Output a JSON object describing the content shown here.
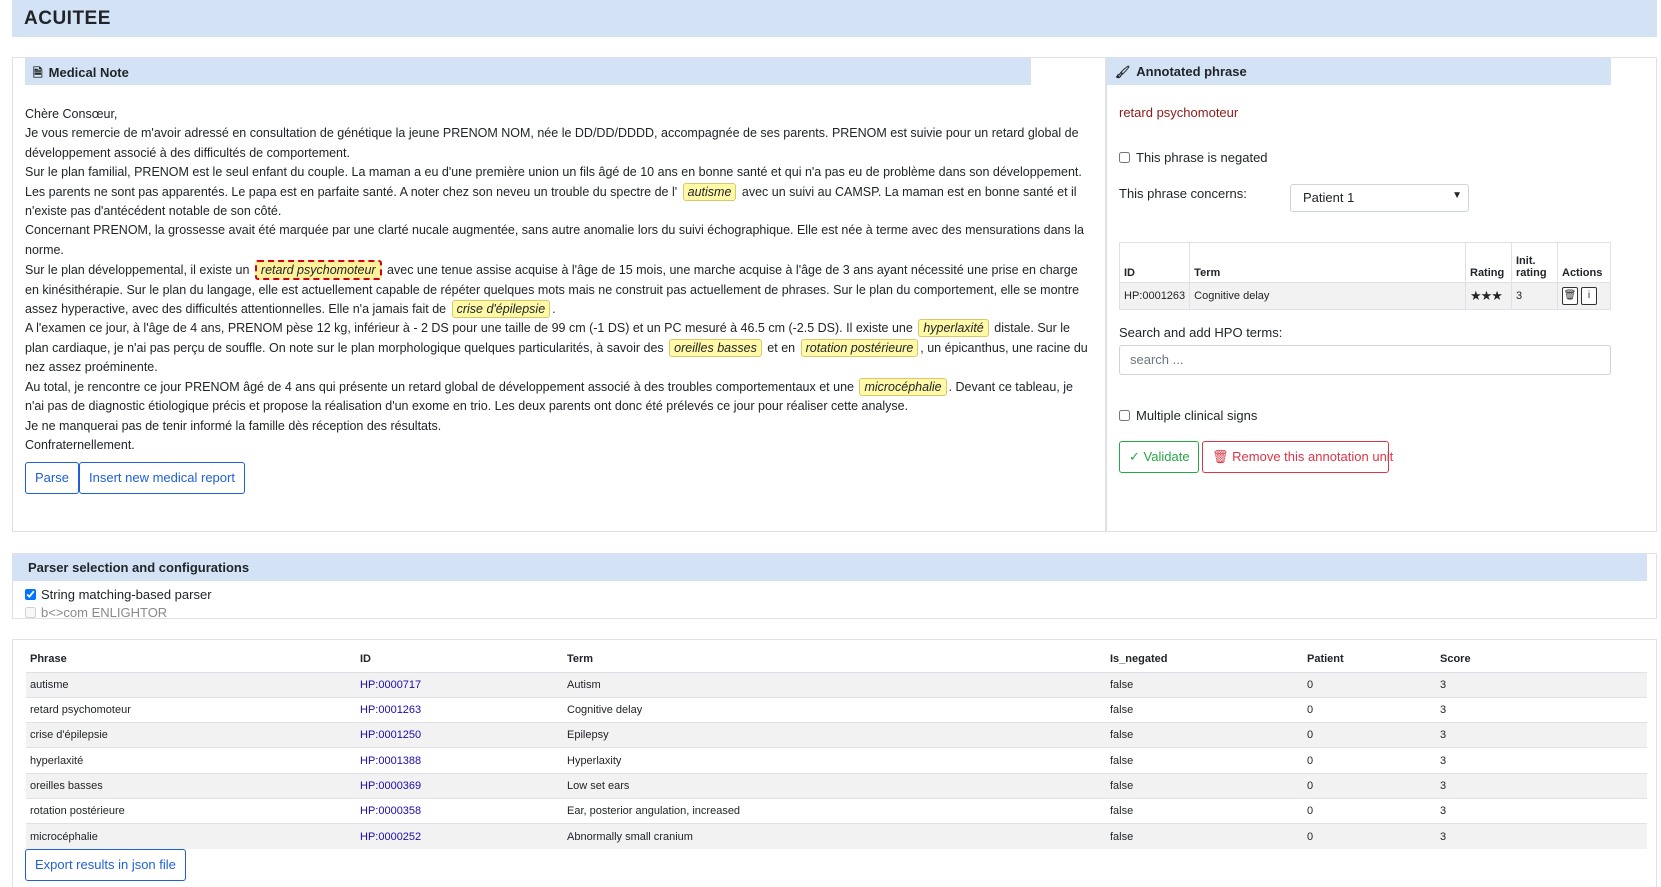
{
  "app": {
    "title": "ACUITEE"
  },
  "note": {
    "header": "Medical Note",
    "header_icon": "file-icon",
    "segments": [
      {
        "t": "Chère Consœur,"
      },
      {
        "br": true
      },
      {
        "t": "Je vous remercie de m'avoir adressé en consultation de génétique la jeune PRENOM NOM, née le DD/DD/DDDD, accompagnée de ses parents. PRENOM est suivie pour un retard global de développement associé à des difficultés de comportement."
      },
      {
        "br": true
      },
      {
        "t": "Sur le plan familial, PRENOM est le seul enfant du couple. La maman a eu d'une première union un fils âgé de 10 ans en bonne santé et qui n'a pas eu de problème dans son développement. Les parents ne sont pas apparentés. Le papa est en parfaite santé. A noter chez son neveu un trouble du spectre de l' "
      },
      {
        "hl": "autisme"
      },
      {
        "t": " avec un suivi au CAMSP. La maman est en bonne santé et il n'existe pas d'antécédent notable de son côté."
      },
      {
        "br": true
      },
      {
        "t": "Concernant PRENOM, la grossesse avait été marquée par une clarté nucale augmentée, sans autre anomalie lors du suivi échographique. Elle est née à terme avec des mensurations dans la norme."
      },
      {
        "br": true
      },
      {
        "t": "Sur le plan développemental, il existe un "
      },
      {
        "hl": "retard psychomoteur",
        "sel": true
      },
      {
        "t": " avec une tenue assise acquise à l'âge de 15 mois, une marche acquise à l'âge de 3 ans ayant nécessité une prise en charge en kinésithérapie. Sur le plan du langage, elle est actuellement capable de répéter quelques mots mais ne construit pas actuellement de phrases. Sur le plan du comportement, elle se montre assez hyperactive, avec des difficultés attentionnelles. Elle n'a jamais fait de "
      },
      {
        "hl": "crise d'épilepsie"
      },
      {
        "t": "."
      },
      {
        "br": true
      },
      {
        "t": "A l'examen ce jour, à l'âge de 4 ans, PRENOM pèse 12 kg, inférieur à - 2 DS pour une taille de 99 cm (-1 DS) et un PC mesuré à 46.5 cm (-2.5 DS). Il existe une "
      },
      {
        "hl": "hyperlaxité"
      },
      {
        "t": " distale. Sur le plan cardiaque, je n'ai pas perçu de souffle. On note sur le plan morphologique quelques particularités, à savoir des "
      },
      {
        "hl": "oreilles basses"
      },
      {
        "t": " et en "
      },
      {
        "hl": "rotation postérieure"
      },
      {
        "t": ", un épicanthus, une racine du nez assez proéminente."
      },
      {
        "br": true
      },
      {
        "t": "Au total, je rencontre ce jour PRENOM âgé de 4 ans qui présente un retard global de développement associé à des troubles comportementaux et une "
      },
      {
        "hl": "microcéphalie"
      },
      {
        "t": ". Devant ce tableau, je n'ai pas de diagnostic étiologique précis et propose la réalisation d'un exome en trio. Les deux parents ont donc été prélevés ce jour pour réaliser cette analyse."
      },
      {
        "br": true
      },
      {
        "t": "Je ne manquerai pas de tenir informé la famille dès réception des résultats."
      },
      {
        "br": true
      },
      {
        "t": "Confraternellement."
      }
    ],
    "parse_button": "Parse",
    "insert_button": "Insert new medical report"
  },
  "annotation": {
    "header": "Annotated phrase",
    "header_icon": "pen-icon",
    "phrase": "retard psychomoteur",
    "negated_label": "This phrase is negated",
    "negated_checked": false,
    "concerns_label": "This phrase concerns:",
    "concerns_value": "Patient 1",
    "table_headers": [
      "ID",
      "Term",
      "Rating",
      "Init. rating",
      "Actions"
    ],
    "rows": [
      {
        "id": "HP:0001263",
        "term": "Cognitive delay",
        "rating": "★★★",
        "init_rating": "3"
      }
    ],
    "search_label": "Search and add HPO terms:",
    "search_placeholder": "search ...",
    "multiple_label": "Multiple clinical signs",
    "multiple_checked": false,
    "validate_button": "Validate",
    "remove_button": "Remove this annotation unit"
  },
  "parser": {
    "header": "Parser selection and configurations",
    "options": [
      {
        "label": "String matching-based parser",
        "checked": true,
        "disabled": false
      },
      {
        "label": "b<>com ENLIGHTOR",
        "checked": false,
        "disabled": true
      }
    ]
  },
  "results": {
    "headers": [
      "Phrase",
      "ID",
      "Term",
      "Is_negated",
      "Patient",
      "Score"
    ],
    "rows": [
      {
        "phrase": "autisme",
        "id": "HP:0000717",
        "term": "Autism",
        "neg": "false",
        "patient": "0",
        "score": "3"
      },
      {
        "phrase": "retard psychomoteur",
        "id": "HP:0001263",
        "term": "Cognitive delay",
        "neg": "false",
        "patient": "0",
        "score": "3"
      },
      {
        "phrase": "crise d'épilepsie",
        "id": "HP:0001250",
        "term": "Epilepsy",
        "neg": "false",
        "patient": "0",
        "score": "3"
      },
      {
        "phrase": "hyperlaxité",
        "id": "HP:0001388",
        "term": "Hyperlaxity",
        "neg": "false",
        "patient": "0",
        "score": "3"
      },
      {
        "phrase": "oreilles basses",
        "id": "HP:0000369",
        "term": "Low set ears",
        "neg": "false",
        "patient": "0",
        "score": "3"
      },
      {
        "phrase": "rotation postérieure",
        "id": "HP:0000358",
        "term": "Ear, posterior angulation, increased",
        "neg": "false",
        "patient": "0",
        "score": "3"
      },
      {
        "phrase": "microcéphalie",
        "id": "HP:0000252",
        "term": "Abnormally small cranium",
        "neg": "false",
        "patient": "0",
        "score": "3"
      }
    ],
    "export_button": "Export results in json file"
  }
}
